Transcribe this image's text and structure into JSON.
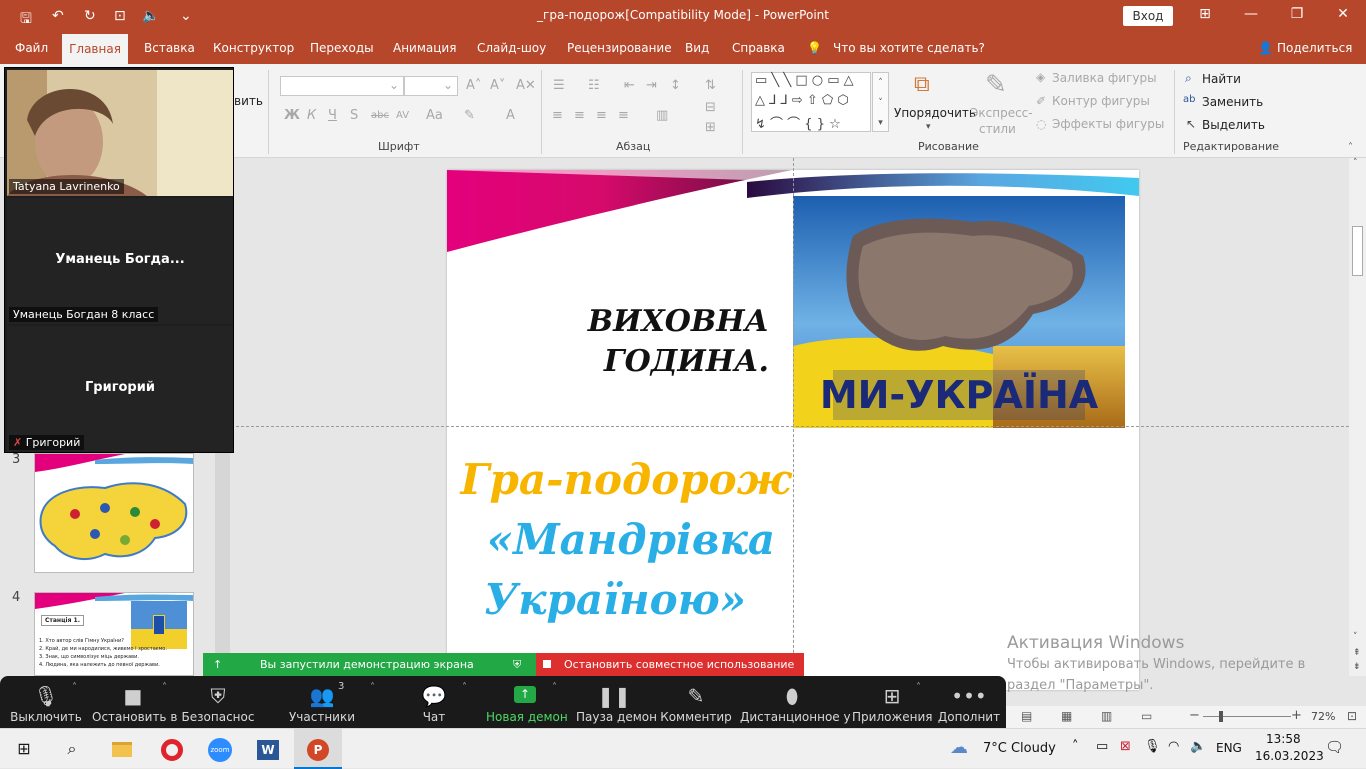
{
  "titlebar": {
    "doc_title": "_гра-подорож[Compatibility Mode]  -  PowerPoint",
    "signin": "Вход"
  },
  "menu": {
    "items": [
      "Файл",
      "Главная",
      "Вставка",
      "Конструктор",
      "Переходы",
      "Анимация",
      "Слайд-шоу",
      "Рецензирование",
      "Вид",
      "Справка"
    ],
    "tell_me": "Что вы хотите сделать?",
    "share": "Поделиться"
  },
  "ribbon": {
    "paste_partial": "вить",
    "font_group": "Шрифт",
    "paragraph_group": "Абзац",
    "drawing_group": "Рисование",
    "editing_group": "Редактирование",
    "arrange": "Упорядочить",
    "quick_styles_1": "Экспресс-",
    "quick_styles_2": "стили",
    "shape_fill": "Заливка фигуры",
    "shape_outline": "Контур фигуры",
    "shape_effects": "Эффекты фигуры",
    "find": "Найти",
    "replace": "Заменить",
    "select": "Выделить",
    "font_btns": [
      "Ж",
      "К",
      "Ч",
      "abc",
      "AV",
      "Aa",
      "A"
    ]
  },
  "slide": {
    "title_line1": "ВИХОВНА",
    "title_line2": "ГОДИНА.",
    "image_caption": "МИ-УКРАЇНА",
    "game_line1": "Гра-подорож",
    "game_line2": "«Мандрівка",
    "game_line3": "Україною»",
    "colors": {
      "orange": "#f7b500",
      "blue": "#29aee6",
      "magenta": "#e4007c"
    }
  },
  "thumbs": [
    {
      "num": "3"
    },
    {
      "num": "4",
      "heading": "Станція 1.",
      "lines": [
        "1. Хто автор слів Гімну України?",
        "2. Край, де ми народилися, живемо і зростаємо.",
        "3. Знак, що символізує міць держави.",
        "4. Людина, яка належить до певної держави."
      ]
    }
  ],
  "video": {
    "tiles": [
      {
        "name": "Tatyana Lavrinenko"
      },
      {
        "name": "Уманець Богдан 8 класс",
        "center": "Уманець  Богда..."
      },
      {
        "name": "Григорий",
        "center": "Григорий"
      }
    ]
  },
  "share_banner": {
    "sharing": "Вы запустили демонстрацию экрана",
    "stop": "Остановить совместное использование"
  },
  "activation": {
    "title": "Активация Windows",
    "line1": "Чтобы активировать Windows, перейдите в",
    "line2": "раздел \"Параметры\"."
  },
  "status": {
    "zoom": "72%"
  },
  "zoombar": {
    "mute": "Выключить",
    "video": "Остановить в",
    "security": "Безопаснос",
    "participants": "Участники",
    "participants_count": "3",
    "chat": "Чат",
    "new_share": "Новая демон",
    "pause_share": "Пауза демон",
    "annotate": "Комментир",
    "remote": "Дистанционное у",
    "apps": "Приложения",
    "more": "Дополнит"
  },
  "taskbar": {
    "weather": "7°C  Cloudy",
    "lang": "ENG",
    "time": "13:58",
    "date": "16.03.2023"
  }
}
